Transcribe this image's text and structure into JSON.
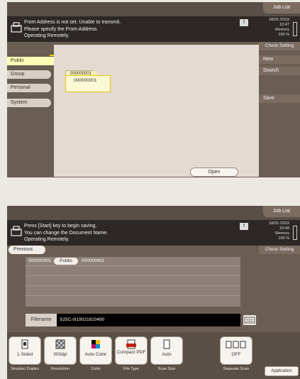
{
  "panel1": {
    "job_list": "Job List",
    "message": [
      "From Address is not set. Unable to transmit.",
      "Please specify the From Address.",
      "Operating Remotely."
    ],
    "info_icon": "!",
    "clock": {
      "date": "18/02 /2019",
      "time": "10:47",
      "memory_label": "Memory",
      "memory_value": "100 %"
    },
    "check_setting": "Check Setting",
    "tabs": [
      "Public",
      "Group",
      "Personal",
      "System"
    ],
    "folder": {
      "tab_text": "000000001",
      "name": "000000001"
    },
    "side_buttons": [
      "New",
      "Search",
      "Save"
    ],
    "open": "Open"
  },
  "panel2": {
    "job_list": "Job List",
    "message": [
      "Press [Start] key to begin saving.",
      "You can change the Document Name.",
      "Operating Remotely."
    ],
    "info_icon": "!",
    "clock": {
      "date": "18/02 /2019",
      "time": "10:49",
      "memory_label": "Memory",
      "memory_value": "100 %"
    },
    "check_setting": "Check Setting",
    "previous": "Previous",
    "list_row": {
      "id": "000000001",
      "type": "Public",
      "name": "000000001"
    },
    "filename_label": "Filename",
    "filename_value": "S25C-0i19021810490",
    "functions": [
      {
        "value": "1-Sided",
        "label": "Simplex/ Duplex",
        "icon": "one-sided-icon"
      },
      {
        "value": "300dpi",
        "label": "Resolution",
        "icon": "resolution-icon"
      },
      {
        "value": "Auto Color",
        "label": "Color",
        "icon": "color-icon"
      },
      {
        "value": "Compact PDF",
        "label": "File Type",
        "icon": "pdf-icon"
      },
      {
        "value": "Auto",
        "label": "Scan Size",
        "icon": "page-icon"
      },
      {
        "value": "OFF",
        "label": "Separate Scan",
        "icon": "separate-scan-icon"
      }
    ],
    "application": "Application"
  }
}
